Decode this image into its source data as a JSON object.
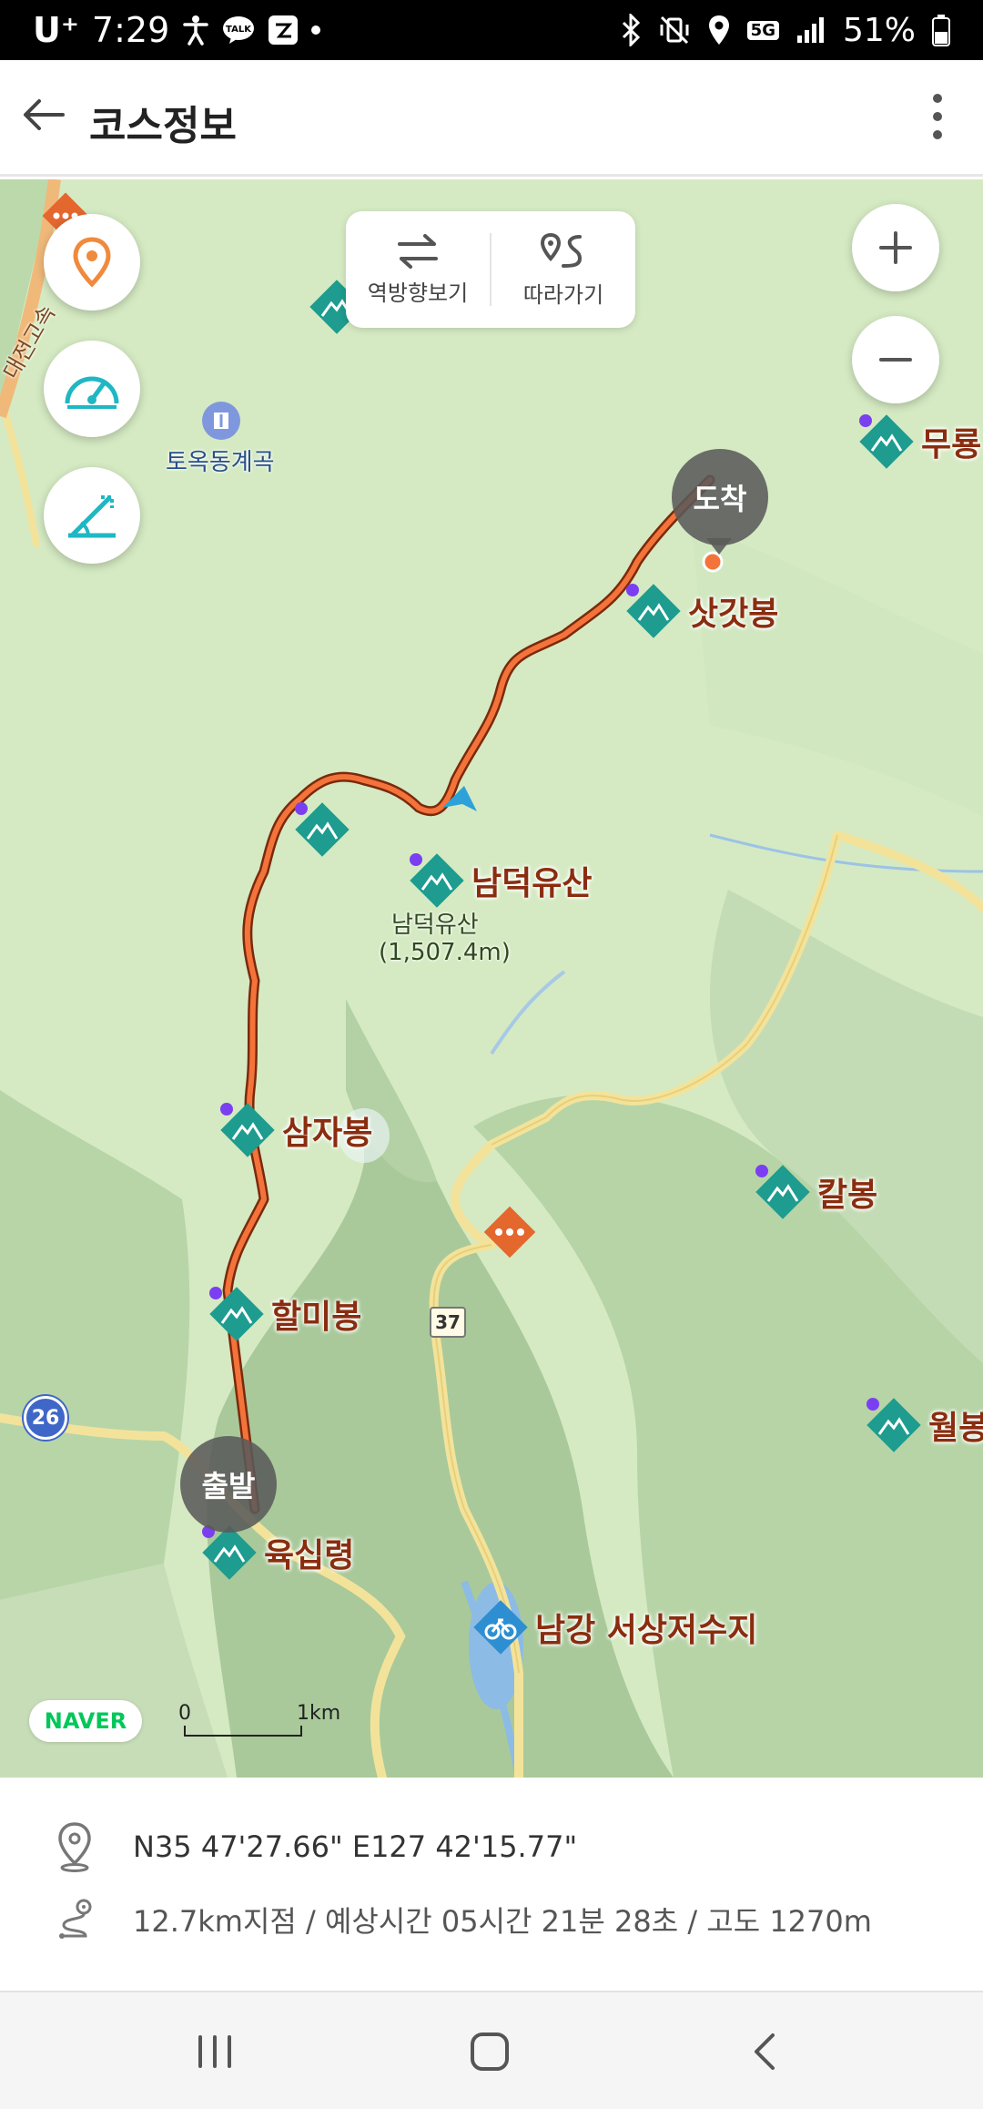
{
  "status_bar": {
    "carrier": "U⁺",
    "time": "7:29",
    "battery": "51%",
    "network": "5G"
  },
  "app_bar": {
    "title": "코스정보"
  },
  "map": {
    "toggle": {
      "reverse_label": "역방향보기",
      "follow_label": "따라가기"
    },
    "labels": {
      "highway": "대전고속",
      "valley": "토옥동계곡",
      "summit_name": "남덕유산",
      "summit_elev": "(1,507.4m)",
      "route_37": "37",
      "route_26": "26"
    },
    "pins": {
      "arrive": "도착",
      "start": "출발"
    },
    "peaks": {
      "satgatbong": "삿갓봉",
      "namdeokyusan": "남덕유산",
      "samjabong": "삼자봉",
      "halmibong": "할미봉",
      "yuksimnyeong": "육십령",
      "kalbong": "칼봉",
      "muryong": "무룡",
      "wolbong": "월봉"
    },
    "reservoir": "남강 서상저수지",
    "naver_logo": "NAVER",
    "scale": {
      "zero": "0",
      "one": "1km"
    }
  },
  "info": {
    "coordinates": "N35 47'27.66\" E127 42'15.77\"",
    "detail": "12.7km지점 / 예상시간 05시간 21분 28초 / 고도 1270m"
  },
  "colors": {
    "route": "#f4733a",
    "peak": "#1d9c8f",
    "accent_orange": "#f08a3c",
    "teal": "#1fb7c4",
    "map_bg": "#d7ebc6"
  }
}
